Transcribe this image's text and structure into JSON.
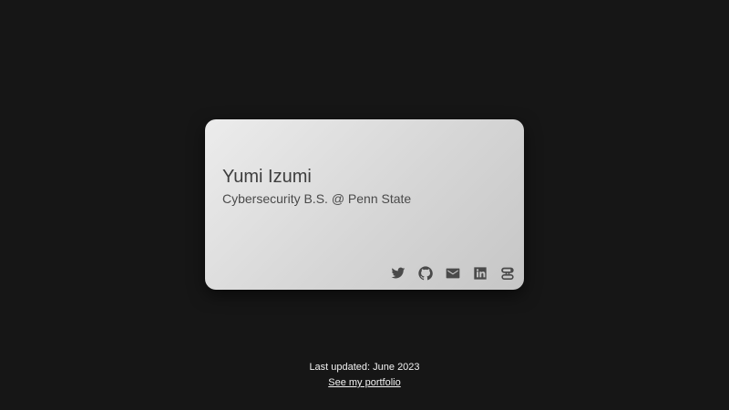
{
  "card": {
    "name": "Yumi Izumi",
    "subtitle": "Cybersecurity B.S. @ Penn State",
    "social_links": [
      {
        "icon": "twitter-icon"
      },
      {
        "icon": "github-icon"
      },
      {
        "icon": "email-icon"
      },
      {
        "icon": "linkedin-icon"
      },
      {
        "icon": "s-logo-icon"
      }
    ]
  },
  "footer": {
    "updated": "Last updated: June 2023",
    "portfolio_link": "See my portfolio"
  },
  "colors": {
    "page_background": "#161616",
    "card_gradient_start": "#ececec",
    "card_gradient_end": "#c6c6c6",
    "card_text": "#3e3e3e",
    "footer_text": "#f2f2f2"
  }
}
